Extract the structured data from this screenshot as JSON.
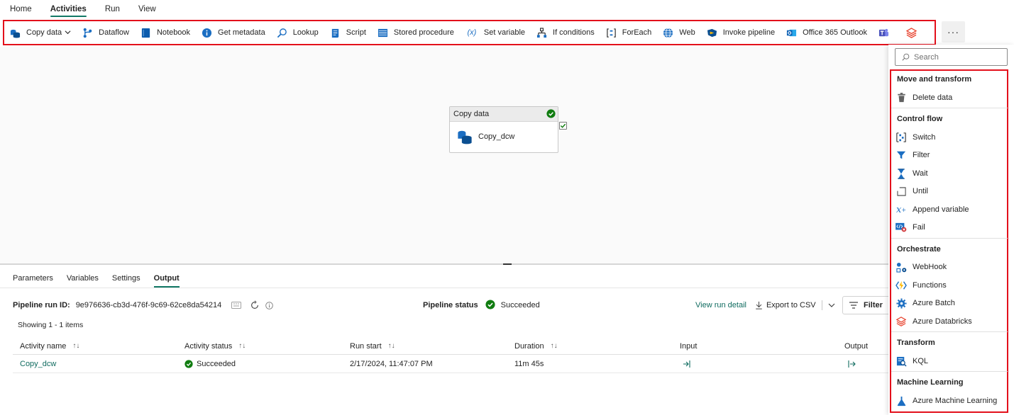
{
  "top_tabs": [
    {
      "label": "Home"
    },
    {
      "label": "Activities",
      "active": true
    },
    {
      "label": "Run"
    },
    {
      "label": "View"
    }
  ],
  "ribbon": {
    "items": [
      {
        "label": "Copy data",
        "icon": "copy-data-icon",
        "dropdown": true
      },
      {
        "label": "Dataflow",
        "icon": "dataflow-icon"
      },
      {
        "label": "Notebook",
        "icon": "notebook-icon"
      },
      {
        "label": "Get metadata",
        "icon": "info-icon"
      },
      {
        "label": "Lookup",
        "icon": "lookup-icon"
      },
      {
        "label": "Script",
        "icon": "script-icon"
      },
      {
        "label": "Stored procedure",
        "icon": "stored-procedure-icon"
      },
      {
        "label": "Set variable",
        "icon": "variable-icon"
      },
      {
        "label": "If conditions",
        "icon": "if-conditions-icon"
      },
      {
        "label": "ForEach",
        "icon": "foreach-icon"
      },
      {
        "label": "Web",
        "icon": "globe-icon"
      },
      {
        "label": "Invoke pipeline",
        "icon": "invoke-pipeline-icon"
      },
      {
        "label": "Office 365 Outlook",
        "icon": "outlook-icon"
      }
    ],
    "extra_icons": [
      "teams-icon",
      "databricks-icon"
    ],
    "more_label": "···"
  },
  "canvas": {
    "node": {
      "header": "Copy data",
      "name": "Copy_dcw"
    }
  },
  "panel": {
    "tabs": [
      {
        "label": "Parameters"
      },
      {
        "label": "Variables"
      },
      {
        "label": "Settings"
      },
      {
        "label": "Output",
        "active": true
      }
    ],
    "run_id_label": "Pipeline run ID:",
    "run_id": "9e976636-cb3d-476f-9c69-62ce8da54214",
    "status_label": "Pipeline status",
    "status_value": "Succeeded",
    "view_run_detail": "View run detail",
    "export_csv": "Export to CSV",
    "filter_label": "Filter",
    "showing": "Showing 1 - 1 items",
    "columns": [
      "Activity name",
      "Activity status",
      "Run start",
      "Duration",
      "Input",
      "Output"
    ],
    "rows": [
      {
        "activity_name": "Copy_dcw",
        "status": "Succeeded",
        "run_start": "2/17/2024, 11:47:07 PM",
        "duration": "11m 45s"
      }
    ]
  },
  "flyout": {
    "search_placeholder": "Search",
    "sections": [
      {
        "title": "Move and transform",
        "items": [
          {
            "label": "Delete data",
            "icon": "trash-icon"
          }
        ]
      },
      {
        "title": "Control flow",
        "items": [
          {
            "label": "Switch",
            "icon": "switch-icon"
          },
          {
            "label": "Filter",
            "icon": "filter-icon"
          },
          {
            "label": "Wait",
            "icon": "hourglass-icon"
          },
          {
            "label": "Until",
            "icon": "until-icon"
          },
          {
            "label": "Append variable",
            "icon": "append-variable-icon"
          },
          {
            "label": "Fail",
            "icon": "fail-icon"
          }
        ]
      },
      {
        "title": "Orchestrate",
        "items": [
          {
            "label": "WebHook",
            "icon": "webhook-icon"
          },
          {
            "label": "Functions",
            "icon": "functions-icon"
          },
          {
            "label": "Azure Batch",
            "icon": "gear-icon"
          },
          {
            "label": "Azure Databricks",
            "icon": "databricks-icon"
          }
        ]
      },
      {
        "title": "Transform",
        "items": [
          {
            "label": "KQL",
            "icon": "kql-icon"
          }
        ]
      },
      {
        "title": "Machine Learning",
        "items": [
          {
            "label": "Azure Machine Learning",
            "icon": "flask-icon"
          }
        ]
      }
    ]
  },
  "colors": {
    "accent": "#117865",
    "highlight_border": "#e3101b",
    "success": "#107c10",
    "link": "#0f6b5f"
  }
}
